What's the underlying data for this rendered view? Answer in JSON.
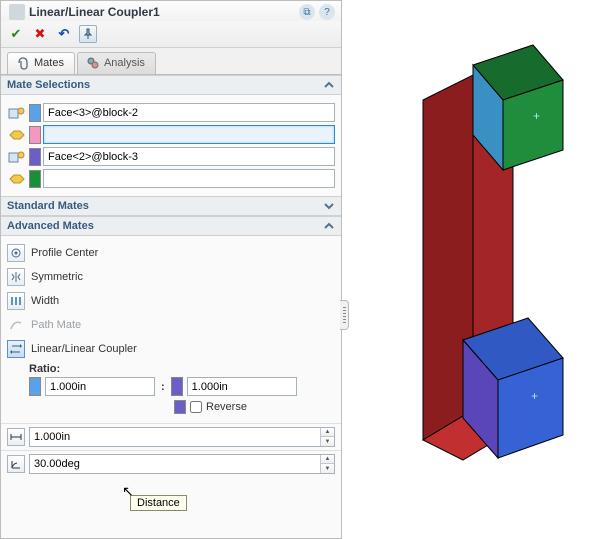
{
  "title": "Linear/Linear Coupler1",
  "tabs": {
    "mates": "Mates",
    "analysis": "Analysis"
  },
  "sections": {
    "mate_selections": "Mate Selections",
    "standard_mates": "Standard Mates",
    "advanced_mates": "Advanced Mates"
  },
  "selections": {
    "a": {
      "value": "Face<3>@block-2",
      "swatch": "#5aa2e8"
    },
    "b": {
      "value": "",
      "swatch": "#f596c3"
    },
    "c": {
      "value": "Face<2>@block-3",
      "swatch": "#6a5fc6"
    },
    "d": {
      "value": "",
      "swatch": "#1a8f3a"
    }
  },
  "advanced": {
    "profile_center": "Profile Center",
    "symmetric": "Symmetric",
    "width": "Width",
    "path_mate": "Path Mate",
    "linear_coupler": "Linear/Linear Coupler"
  },
  "ratio": {
    "label": "Ratio:",
    "a": "1.000in",
    "b": "1.000in",
    "a_swatch": "#5aa2e8",
    "b_swatch": "#6a5fc6",
    "reverse_swatch": "#6a5fc6",
    "reverse": "Reverse"
  },
  "spinners": {
    "distance": "1.000in",
    "angle": "30.00deg"
  },
  "tooltip": "Distance"
}
